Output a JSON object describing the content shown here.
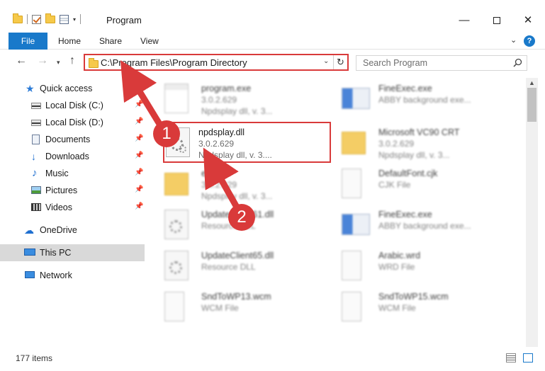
{
  "window": {
    "title": "Program",
    "minimize": "—",
    "close": "✕"
  },
  "ribbon": {
    "file": "File",
    "home": "Home",
    "share": "Share",
    "view": "View",
    "help": "?"
  },
  "address": {
    "path": "C:\\Program Files\\Program Directory",
    "refresh": "↻"
  },
  "search": {
    "placeholder": "Search Program"
  },
  "sidebar": {
    "items": [
      {
        "label": "Quick access"
      },
      {
        "label": "Local Disk (C:)"
      },
      {
        "label": "Local Disk (D:)"
      },
      {
        "label": "Documents"
      },
      {
        "label": "Downloads"
      },
      {
        "label": "Music"
      },
      {
        "label": "Pictures"
      },
      {
        "label": "Videos"
      },
      {
        "label": "OneDrive"
      },
      {
        "label": "This PC"
      },
      {
        "label": "Network"
      }
    ]
  },
  "files": [
    {
      "name": "program.exe",
      "line2": "3.0.2.629",
      "line3": "Npdsplay dll, v. 3..."
    },
    {
      "name": "FineExec.exe",
      "line2": "ABBY background exe...",
      "line3": ""
    },
    {
      "name": "npdsplay.dll",
      "line2": "3.0.2.629",
      "line3": "Npdsplay dll, v. 3...."
    },
    {
      "name": "Microsoft VC90 CRT",
      "line2": "3.0.2.629",
      "line3": "Npdsplay dll, v. 3..."
    },
    {
      "name": "el",
      "line2": "3.0.2.629",
      "line3": "Npdsplay dll, v. 3..."
    },
    {
      "name": "DefaultFont.cjk",
      "line2": "CJK File",
      "line3": ""
    },
    {
      "name": "UpdateClient61.dll",
      "line2": "Resource DLL",
      "line3": ""
    },
    {
      "name": "FineExec.exe",
      "line2": "ABBY background exe...",
      "line3": ""
    },
    {
      "name": "UpdateClient65.dll",
      "line2": "Resource DLL",
      "line3": ""
    },
    {
      "name": "Arabic.wrd",
      "line2": "WRD File",
      "line3": ""
    },
    {
      "name": "SndToWP13.wcm",
      "line2": "WCM File",
      "line3": ""
    },
    {
      "name": "SndToWP15.wcm",
      "line2": "WCM File",
      "line3": ""
    }
  ],
  "annotations": {
    "step1": "1",
    "step2": "2",
    "accent": "#d93a3a"
  },
  "status": {
    "count": "177 items"
  }
}
